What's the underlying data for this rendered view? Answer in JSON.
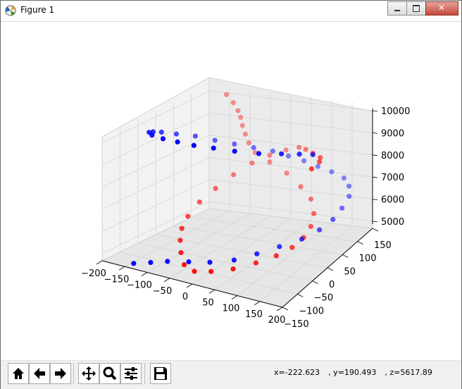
{
  "window": {
    "title": "Figure 1",
    "close_label": "✕"
  },
  "status": {
    "x": "x=-222.623",
    "y": ", y=190.493",
    "z": ", z=5617.89"
  },
  "toolbar": {
    "items": [
      "home-icon",
      "back-arrow-icon",
      "forward-arrow-icon",
      "pan-icon",
      "zoom-icon",
      "configure-subplots-icon",
      "save-icon"
    ]
  },
  "colors": {
    "red_series": "#ff0000",
    "blue_series": "#0000ff",
    "pane": "#f2f2f2",
    "grid": "#d4d4d4"
  },
  "chart_data": {
    "type": "scatter",
    "projection": "3d",
    "title": "",
    "xlabel": "",
    "ylabel": "",
    "zlabel": "",
    "xlim": [
      -200,
      200
    ],
    "ylim": [
      -150,
      150
    ],
    "zlim": [
      5000,
      10000
    ],
    "x_ticks": [
      "−200",
      "−150",
      "−100",
      "−50",
      "0",
      "50",
      "100",
      "150",
      "200"
    ],
    "y_ticks": [
      "−150",
      "−100",
      "−50",
      "0",
      "50",
      "100",
      "150"
    ],
    "z_ticks": [
      "5000",
      "6000",
      "7000",
      "8000",
      "9000",
      "10000"
    ],
    "grid": true,
    "series": [
      {
        "color": "#ff0000",
        "points": [
          [
            -175,
            170,
            9800
          ],
          [
            -160,
            172,
            9450
          ],
          [
            -150,
            174,
            9100
          ],
          [
            -145,
            176,
            8800
          ],
          [
            -140,
            175,
            8450
          ],
          [
            -130,
            172,
            8100
          ],
          [
            -120,
            170,
            7750
          ],
          [
            -100,
            165,
            7400
          ],
          [
            -60,
            160,
            7100
          ],
          [
            -10,
            150,
            6800
          ],
          [
            40,
            130,
            6500
          ],
          [
            80,
            110,
            6250
          ],
          [
            110,
            80,
            6000
          ],
          [
            125,
            50,
            5800
          ],
          [
            130,
            20,
            5650
          ],
          [
            125,
            -10,
            5520
          ],
          [
            110,
            -40,
            5420
          ],
          [
            85,
            -70,
            5320
          ],
          [
            55,
            -100,
            5230
          ],
          [
            20,
            -120,
            5160
          ],
          [
            -10,
            -130,
            5120
          ],
          [
            -40,
            -120,
            5170
          ],
          [
            -70,
            -90,
            5280
          ],
          [
            -95,
            -60,
            5440
          ],
          [
            -115,
            -30,
            5620
          ],
          [
            -125,
            0,
            5860
          ],
          [
            -130,
            40,
            6140
          ],
          [
            -125,
            80,
            6430
          ],
          [
            -115,
            120,
            6740
          ],
          [
            -95,
            150,
            7060
          ],
          [
            -60,
            160,
            7400
          ],
          [
            -20,
            160,
            7720
          ],
          [
            20,
            150,
            8010
          ],
          [
            60,
            120,
            8280
          ],
          [
            100,
            90,
            8500
          ],
          [
            140,
            60,
            8700
          ],
          [
            160,
            30,
            8870
          ],
          [
            170,
            -10,
            8990
          ]
        ]
      },
      {
        "color": "#0000ff",
        "points": [
          [
            -130,
            -150,
            5050
          ],
          [
            -100,
            -140,
            5150
          ],
          [
            -70,
            -130,
            5250
          ],
          [
            -30,
            -120,
            5330
          ],
          [
            10,
            -110,
            5400
          ],
          [
            50,
            -90,
            5480
          ],
          [
            80,
            -60,
            5580
          ],
          [
            110,
            -30,
            5700
          ],
          [
            140,
            0,
            5820
          ],
          [
            160,
            30,
            5970
          ],
          [
            170,
            60,
            6130
          ],
          [
            170,
            90,
            6300
          ],
          [
            165,
            120,
            6480
          ],
          [
            150,
            140,
            6680
          ],
          [
            130,
            150,
            6890
          ],
          [
            100,
            150,
            7100
          ],
          [
            70,
            145,
            7320
          ],
          [
            40,
            140,
            7550
          ],
          [
            10,
            130,
            7780
          ],
          [
            -20,
            120,
            8010
          ],
          [
            -50,
            100,
            8250
          ],
          [
            -80,
            80,
            8480
          ],
          [
            -110,
            60,
            8700
          ],
          [
            -140,
            40,
            8930
          ],
          [
            -160,
            10,
            9150
          ],
          [
            -170,
            -20,
            9380
          ],
          [
            -165,
            -50,
            9600
          ],
          [
            -150,
            -80,
            9820
          ],
          [
            -120,
            -110,
            10020
          ],
          [
            -80,
            -130,
            10180
          ],
          [
            -40,
            -140,
            10300
          ],
          [
            0,
            -145,
            10380
          ],
          [
            40,
            -140,
            10420
          ],
          [
            80,
            -130,
            10400
          ],
          [
            120,
            -110,
            10320
          ],
          [
            150,
            -80,
            10180
          ],
          [
            170,
            -50,
            9980
          ],
          [
            180,
            -20,
            9720
          ]
        ]
      }
    ]
  }
}
